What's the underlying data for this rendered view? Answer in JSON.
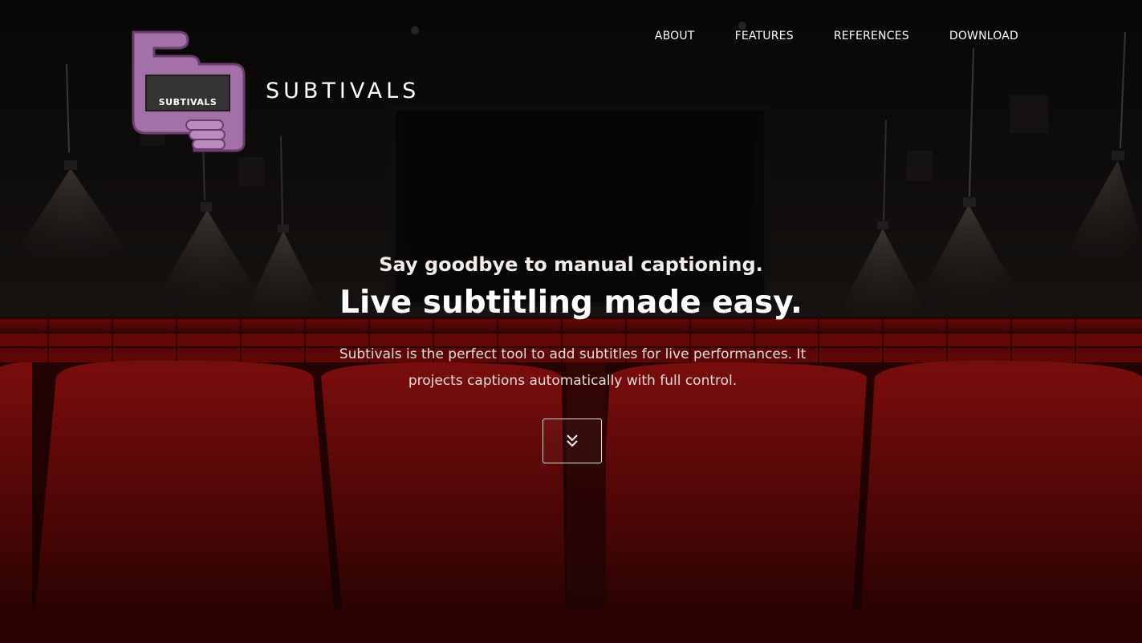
{
  "brand": {
    "name": "SUBTIVALS",
    "logo_icon": "subtivals-logo-icon",
    "logo_text": "SUBTIVALS",
    "logo_color": "#a470a8"
  },
  "nav": {
    "items": [
      {
        "label": "ABOUT"
      },
      {
        "label": "FEATURES"
      },
      {
        "label": "REFERENCES"
      },
      {
        "label": "DOWNLOAD"
      }
    ]
  },
  "hero": {
    "subtitle": "Say goodbye to manual captioning.",
    "title": "Live subtitling made easy.",
    "description": "Subtivals is the perfect tool to add subtitles for live performances. It projects captions automatically with full control.",
    "scroll_icon": "double-chevron-down-icon",
    "background": "dark cinema theater with red seats"
  },
  "colors": {
    "seat_red": "#8a0c0c",
    "overlay": "#000000",
    "text": "#ffffff"
  }
}
